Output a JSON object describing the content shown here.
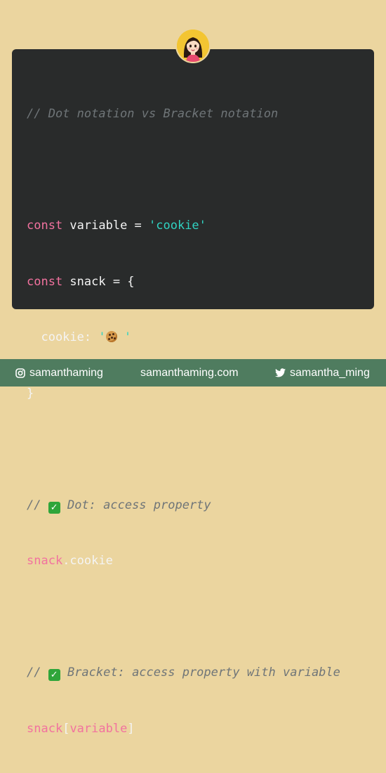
{
  "code": {
    "comment_title": "// Dot notation vs Bracket notation",
    "const_keyword_1": "const",
    "variable_name": " variable = ",
    "string_cookie": "'cookie'",
    "const_keyword_2": "const",
    "snack_decl": " snack = {",
    "cookie_key": "  cookie: ",
    "quote_open": "'",
    "quote_close": " '",
    "closing_brace": "}",
    "comment_dot_prefix": "// ",
    "comment_dot_text": " Dot: access property",
    "snack_obj_1": "snack",
    "dot_access": ".cookie",
    "comment_bracket_prefix": "// ",
    "comment_bracket_text": " Bracket: access property with variable",
    "snack_obj_2": "snack",
    "bracket_open": "[",
    "bracket_var": "variable",
    "bracket_close": "]"
  },
  "icons": {
    "check": "check-mark-icon",
    "cookie": "cookie-emoji-icon",
    "avatar": "avatar-icon",
    "instagram": "instagram-icon",
    "twitter": "twitter-icon"
  },
  "colors": {
    "background": "#ebd59f",
    "card": "#292b2b",
    "keyword": "#f2729f",
    "string": "#30d3c2",
    "comment": "#6f7578",
    "footer": "#4f7c5f"
  },
  "footer": {
    "instagram_handle": "samanthaming",
    "website": "samanthaming.com",
    "twitter_handle": "samantha_ming"
  }
}
